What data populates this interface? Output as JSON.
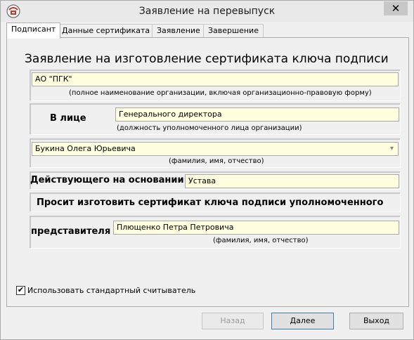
{
  "window": {
    "title": "Заявление на перевыпуск",
    "close_glyph": "✕"
  },
  "tabs": [
    {
      "label": "Подписант",
      "active": true
    },
    {
      "label": "Данные сертификата",
      "active": false
    },
    {
      "label": "Заявление",
      "active": false
    },
    {
      "label": "Завершение",
      "active": false
    }
  ],
  "form": {
    "heading": "Заявление на изготовление сертификата ключа подписи",
    "organization": {
      "value": "АО \"ПГК\"",
      "caption": "(полное наименование организации, включая организационно-правовую форму)"
    },
    "represented_by": {
      "label": "В лице",
      "value": "Генерального директора",
      "caption": "(должность уполномоченного лица организации)"
    },
    "person": {
      "value": "Букина Олега Юрьевича",
      "caption": "(фамилия, имя, отчество)",
      "dropdown_icon": "chevron-down-icon"
    },
    "basis": {
      "label": "Действующего на основании",
      "value": "Устава"
    },
    "request_text": "Просит изготовить сертификат ключа подписи уполномоченного",
    "representative": {
      "label": "представителя",
      "value": "Плющенко Петра Петровича",
      "caption": "(фамилия, имя, отчество)"
    }
  },
  "options": {
    "use_standard_reader": {
      "label": "Использовать стандартный считыватель",
      "checked": true,
      "check_glyph": "✔"
    }
  },
  "buttons": {
    "back": {
      "label": "Назад",
      "enabled": false
    },
    "next": {
      "label": "Далее",
      "enabled": true
    },
    "exit": {
      "label": "Выход",
      "enabled": true
    }
  },
  "colors": {
    "field_bg": "#ffffe0",
    "window_bg": "#f0f0f0",
    "titlebar_bg": "#e9e9e9",
    "close_bg": "#c7c7c7"
  }
}
